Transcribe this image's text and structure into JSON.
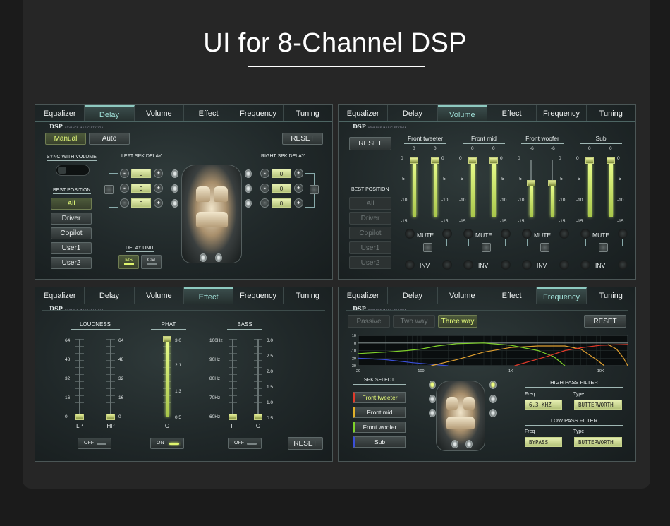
{
  "title": "UI for 8-Channel DSP",
  "tabs": [
    "Equalizer",
    "Delay",
    "Volume",
    "Effect",
    "Frequency",
    "Tuning"
  ],
  "brand": {
    "name": "DSP",
    "tag": "ADVANCE MUSIC STATION"
  },
  "delay": {
    "manual": "Manual",
    "auto": "Auto",
    "reset": "RESET",
    "sync_label": "SYNC WITH VOLUME",
    "best_position": "BEST POSITION",
    "positions": [
      "All",
      "Driver",
      "Copilot",
      "User1",
      "User2"
    ],
    "left_spk": "LEFT SPK DELAY",
    "right_spk": "RIGHT SPK DELAY",
    "left_values": [
      "0",
      "0",
      "0"
    ],
    "right_values": [
      "0",
      "0",
      "0"
    ],
    "minus": "-",
    "plus": "+",
    "delay_unit": "DELAY UNIT",
    "ms": "MS",
    "cm": "CM"
  },
  "volume": {
    "reset": "RESET",
    "best_position": "BEST POSITION",
    "positions": [
      "All",
      "Driver",
      "Copilot",
      "User1",
      "User2"
    ],
    "groups": [
      {
        "name": "Front tweeter",
        "values": [
          "0",
          "0"
        ],
        "levels": [
          0,
          0
        ]
      },
      {
        "name": "Front mid",
        "values": [
          "0",
          "0"
        ],
        "levels": [
          0,
          0
        ]
      },
      {
        "name": "Front woofer",
        "values": [
          "-6",
          "-6"
        ],
        "levels": [
          -6,
          -6
        ]
      },
      {
        "name": "Sub",
        "values": [
          "0",
          "0"
        ],
        "levels": [
          0,
          0
        ]
      }
    ],
    "scale": [
      "0",
      "-5",
      "-10",
      "-15"
    ],
    "mute": "MUTE",
    "inv": "INV"
  },
  "effect": {
    "loudness": "LOUDNESS",
    "phat": "PHAT",
    "bass": "BASS",
    "loud_scale": [
      "64",
      "48",
      "32",
      "16",
      "0"
    ],
    "phat_scale": [
      "3.0",
      "2.1",
      "1.3",
      "0.5"
    ],
    "bass_freq": [
      "100Hz",
      "90Hz",
      "80Hz",
      "70Hz",
      "60Hz"
    ],
    "bass_scale": [
      "3.0",
      "2.5",
      "2.0",
      "1.5",
      "1.0",
      "0.5"
    ],
    "slider_labels": {
      "lp": "LP",
      "hp": "HP",
      "g": "G",
      "f": "F",
      "g2": "G"
    },
    "levels": {
      "lp": 0,
      "hp": 0,
      "phat": 3.0,
      "f": 60,
      "g2": 0.5
    },
    "toggle_off": "OFF",
    "toggle_on": "ON",
    "reset": "RESET"
  },
  "frequency": {
    "passive": "Passive",
    "twoway": "Two way",
    "threeway": "Three way",
    "reset": "RESET",
    "y_ticks": [
      "10",
      "0",
      "-10",
      "-20",
      "-30"
    ],
    "x_ticks": [
      "20",
      "100",
      "1K",
      "10K"
    ],
    "spk_select": "SPK SELECT",
    "speakers": [
      {
        "name": "Front tweeter",
        "color": "#e03a2a"
      },
      {
        "name": "Front mid",
        "color": "#e0b02a"
      },
      {
        "name": "Front woofer",
        "color": "#7fd12a"
      },
      {
        "name": "Sub",
        "color": "#3a4fd8"
      }
    ],
    "hpf": "HIGH PASS FILTER",
    "lpf": "LOW PASS FILTER",
    "freq": "Freq",
    "type": "Type",
    "hpf_freq": "6.3 KHZ",
    "hpf_type": "BUTTERWORTH",
    "lpf_freq": "BYPASS",
    "lpf_type": "BUTTERWORTH",
    "curve_colors": {
      "red": "#e03a2a",
      "orange": "#e0a030",
      "green": "#7fd12a",
      "blue": "#3a4fd8"
    }
  }
}
